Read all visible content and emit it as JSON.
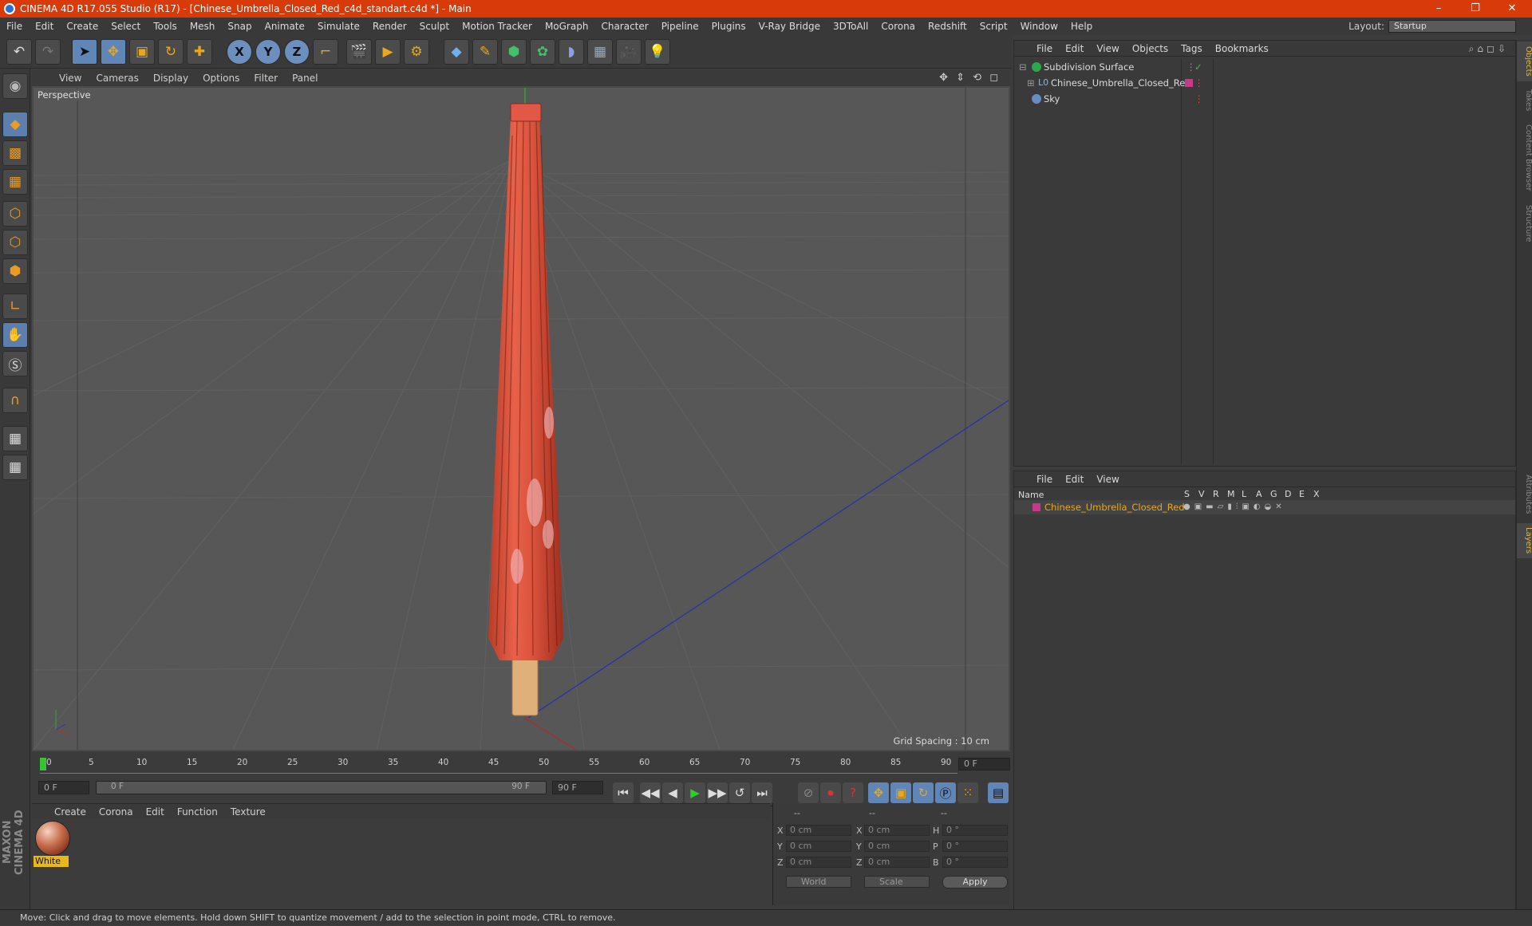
{
  "window": {
    "title": "CINEMA 4D R17.055 Studio (R17) - [Chinese_Umbrella_Closed_Red_c4d_standart.c4d *] - Main",
    "minimize": "–",
    "restore": "❐",
    "close": "✕"
  },
  "menubar": {
    "items": [
      "File",
      "Edit",
      "Create",
      "Select",
      "Tools",
      "Mesh",
      "Snap",
      "Animate",
      "Simulate",
      "Render",
      "Sculpt",
      "Motion Tracker",
      "MoGraph",
      "Character",
      "Pipeline",
      "Plugins",
      "V-Ray Bridge",
      "3DToAll",
      "Corona",
      "Redshift",
      "Script",
      "Window",
      "Help"
    ],
    "layout_label": "Layout:",
    "layout_value": "Startup"
  },
  "toolbar": {
    "undo_icon": "↶",
    "redo_icon": "↷",
    "select_icon": "➤",
    "move_icon": "✥",
    "scale_icon": "▣",
    "rotate_icon": "↻",
    "transform_icon": "✚",
    "x_label": "X",
    "y_label": "Y",
    "z_label": "Z",
    "coord_icon": "⌐",
    "render_view_icon": "🎬",
    "render_icon": "▶",
    "render_settings_icon": "⚙",
    "cube_icon": "◆",
    "pen_icon": "✎",
    "subdiv_icon": "⬢",
    "cloner_icon": "✿",
    "deformer_icon": "◗",
    "floor_icon": "▦",
    "camera_icon": "🎥",
    "light_icon": "💡"
  },
  "viewport": {
    "menu": [
      "View",
      "Cameras",
      "Display",
      "Options",
      "Filter",
      "Panel"
    ],
    "label": "Perspective",
    "grid_spacing": "Grid Spacing : 10 cm",
    "nav_icons": "✥ ⇕ ⟲ ◻"
  },
  "timeline": {
    "ticks": [
      "0",
      "5",
      "10",
      "15",
      "20",
      "25",
      "30",
      "35",
      "40",
      "45",
      "50",
      "55",
      "60",
      "65",
      "70",
      "75",
      "80",
      "85",
      "90"
    ],
    "current_frame": "0 F"
  },
  "transport": {
    "start": "0 F",
    "range_start": "0 F",
    "range_end": "90 F",
    "end": "90 F",
    "buttons": [
      "⏮",
      "◀◀",
      "◀",
      "▶",
      "▶▶",
      "⏭",
      "↺"
    ]
  },
  "materials": {
    "menu": [
      "Create",
      "Corona",
      "Edit",
      "Function",
      "Texture"
    ],
    "items": [
      {
        "name": "White"
      }
    ]
  },
  "coordinates": {
    "headers": [
      "--",
      "--",
      "--"
    ],
    "rows": [
      {
        "l1": "X",
        "v1": "0 cm",
        "l2": "X",
        "v2": "0 cm",
        "l3": "H",
        "v3": "0 °"
      },
      {
        "l1": "Y",
        "v1": "0 cm",
        "l2": "Y",
        "v2": "0 cm",
        "l3": "P",
        "v3": "0 °"
      },
      {
        "l1": "Z",
        "v1": "0 cm",
        "l2": "Z",
        "v2": "0 cm",
        "l3": "B",
        "v3": "0 °"
      }
    ],
    "space": "World",
    "mode": "Scale",
    "apply": "Apply"
  },
  "objects": {
    "menu": [
      "File",
      "Edit",
      "View",
      "Objects",
      "Tags",
      "Bookmarks"
    ],
    "items": [
      {
        "name": "Subdivision Surface",
        "color": "#2aa84a"
      },
      {
        "name": "Chinese_Umbrella_Closed_Red",
        "color": "#9ab0d0"
      },
      {
        "name": "Sky",
        "color": "#6a8cc0"
      }
    ]
  },
  "layers": {
    "menu": [
      "File",
      "Edit",
      "View"
    ],
    "header_name": "Name",
    "header_cols": [
      "S",
      "V",
      "R",
      "M",
      "L",
      "A",
      "G",
      "D",
      "E",
      "X"
    ],
    "items": [
      {
        "name": "Chinese_Umbrella_Closed_Red",
        "color": "#c53a86"
      }
    ]
  },
  "right_tabs": [
    "Objects",
    "Takes",
    "Content Browser",
    "Structure",
    "Attributes",
    "Layers"
  ],
  "status": "Move: Click and drag to move elements. Hold down SHIFT to quantize movement / add to the selection in point mode, CTRL to remove.",
  "brand": "MAXON CINEMA 4D"
}
